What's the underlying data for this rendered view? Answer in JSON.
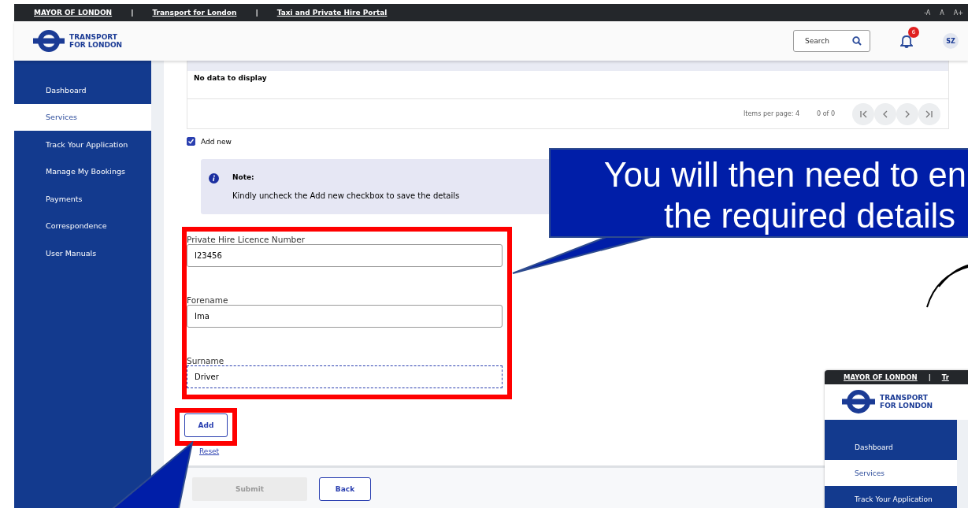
{
  "top_bar": {
    "links": [
      "MAYOR OF LONDON",
      "Transport for London",
      "Taxi and Private Hire Portal"
    ],
    "separator": "|",
    "text_sizes": [
      "-A",
      "A",
      "A+"
    ]
  },
  "header": {
    "logo_lines": [
      "TRANSPORT",
      "FOR LONDON"
    ],
    "search": {
      "placeholder": "Search"
    },
    "notification_count": "6",
    "avatar": "SZ"
  },
  "sidebar": {
    "items": [
      {
        "label": "Dashboard",
        "selected": false
      },
      {
        "label": "Services",
        "selected": true
      },
      {
        "label": "Track Your Application",
        "selected": false
      },
      {
        "label": "Manage My Bookings",
        "selected": false
      },
      {
        "label": "Payments",
        "selected": false
      },
      {
        "label": "Correspondence",
        "selected": false
      },
      {
        "label": "User Manuals",
        "selected": false
      }
    ]
  },
  "table": {
    "empty_text": "No data to display",
    "items_per_page": "Items per page: 4",
    "range": "0 of 0"
  },
  "add_new": {
    "label": "Add new",
    "checked": true
  },
  "note": {
    "title": "Note:",
    "text": "Kindly uncheck the Add new checkbox to save the details"
  },
  "fields": [
    {
      "label": "Private Hire Licence Number",
      "value": "I23456",
      "focused": false
    },
    {
      "label": "Forename",
      "value": "Ima",
      "focused": false
    },
    {
      "label": "Surname",
      "value": "Driver",
      "focused": true
    }
  ],
  "add_button": "Add",
  "reset_link": "Reset",
  "footer_buttons": [
    {
      "label": "Submit",
      "disabled": true
    },
    {
      "label": "Back",
      "disabled": false
    }
  ],
  "callout": {
    "lines": [
      "You will then need to en",
      "the required details"
    ]
  },
  "inset": {
    "top_links": [
      "MAYOR OF LONDON",
      "Tr"
    ],
    "separator": "|",
    "logo_lines": [
      "TRANSPORT",
      "FOR LONDON"
    ],
    "sidebar_items": [
      {
        "label": "Dashboard",
        "selected": false
      },
      {
        "label": "Services",
        "selected": true
      },
      {
        "label": "Track Your Application",
        "selected": false
      }
    ]
  }
}
